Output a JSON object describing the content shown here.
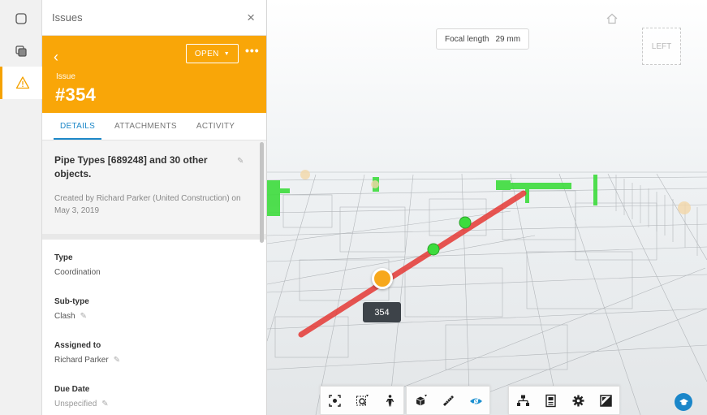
{
  "panel": {
    "title": "Issues",
    "close_glyph": "×",
    "back_glyph": "‹",
    "status_label": "OPEN",
    "more_glyph": "•••",
    "issue_label": "Issue",
    "issue_number": "#354",
    "tabs": [
      {
        "label": "DETAILS",
        "active": true
      },
      {
        "label": "ATTACHMENTS",
        "active": false
      },
      {
        "label": "ACTIVITY",
        "active": false
      }
    ],
    "summary_title": "Pipe Types [689248] and 30 other objects.",
    "created_text": "Created by Richard Parker (United Construction) on May 3, 2019",
    "fields": [
      {
        "label": "Type",
        "value": "Coordination"
      },
      {
        "label": "Sub-type",
        "value": "Clash"
      },
      {
        "label": "Assigned to",
        "value": "Richard Parker"
      },
      {
        "label": "Due Date",
        "value": "Unspecified"
      }
    ]
  },
  "rail": {
    "items": [
      {
        "icon": "model-browser-icon",
        "active": false
      },
      {
        "icon": "layers-icon",
        "active": false
      },
      {
        "icon": "warning-icon",
        "active": true
      }
    ]
  },
  "viewer": {
    "focal_label": "Focal length",
    "focal_value": "29 mm",
    "viewcube_label": "LEFT",
    "pin_label": "354",
    "toolbar_groups": [
      [
        "fit-to-view-icon",
        "zoom-window-icon",
        "first-person-icon"
      ],
      [
        "section-box-icon",
        "measure-icon",
        "explode-view-icon"
      ],
      [
        "model-structure-icon",
        "properties-icon",
        "settings-icon",
        "fullscreen-icon"
      ]
    ]
  },
  "colors": {
    "accent_orange": "#F9A608",
    "accent_blue": "#1D88C8",
    "clash_red": "#E53935",
    "element_green": "#3DDC3D"
  }
}
